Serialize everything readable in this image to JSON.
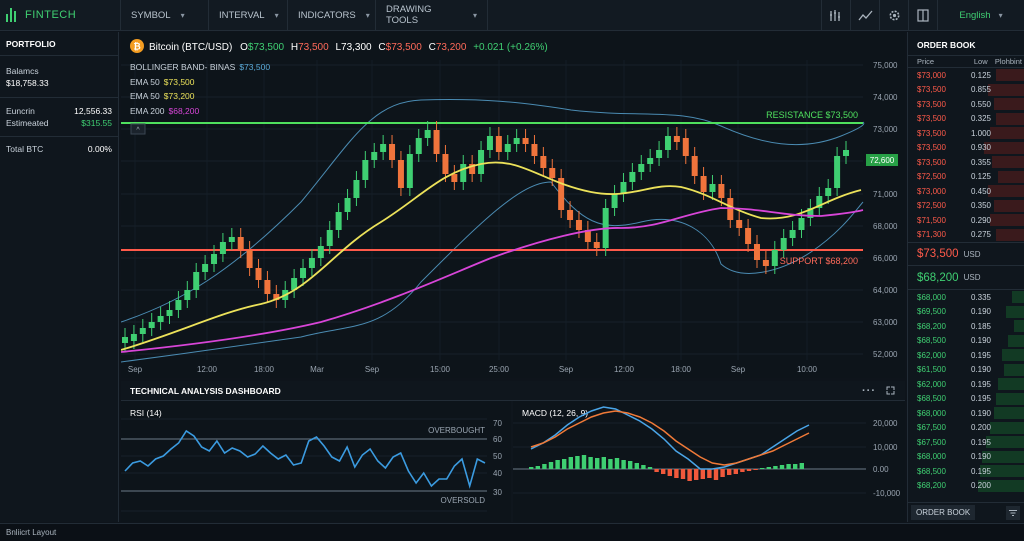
{
  "topbar": {
    "logo": "FINTECH",
    "menus": [
      "SYMBOL",
      "INTERVAL",
      "INDICATORS",
      "DRAWING TOOLS"
    ],
    "language": "English",
    "tool_icons": [
      "indicator-bars-icon",
      "line-chart-icon",
      "gear-icon",
      "panel-icon"
    ]
  },
  "portfolio": {
    "title": "PORTFOLIO",
    "balance_label": "Balamcs",
    "balance_value": "$18,758.33",
    "rows": [
      {
        "label": "Euncrin",
        "value": "12,556.33"
      },
      {
        "label": "Estimeated",
        "value": "$315.55"
      }
    ],
    "total_label": "Total BTC",
    "total_value": "0.00%"
  },
  "header": {
    "title": "Bitcoin (BTC/USD)",
    "o_label": "O",
    "o": "$73,500",
    "h_label": "H",
    "h": "73,500",
    "l_label": "L",
    "l": "73,300",
    "c_label": "C",
    "c": "$73,500",
    "c2_label": "C",
    "c2": "73,200",
    "change": "+0.021 (+0.26%)",
    "coin_symbol": "₿"
  },
  "indicators": [
    {
      "label": "BOLLINGER BAND- BINAS",
      "value": "$73,500",
      "color": "#5aa9d8"
    },
    {
      "label": "EMA 50",
      "value": "$73,500",
      "color": "#e6d94a"
    },
    {
      "label": "EMA 50",
      "value": "$73,200",
      "color": "#e6d94a"
    },
    {
      "label": "EMA 200",
      "value": "$68,200",
      "color": "#d845d8"
    }
  ],
  "resistance_label": "RESISTANCE $73,500",
  "support_label": "SUPPORT $68,200",
  "price_tag": "72,600",
  "y_ticks": [
    "75,000",
    "74,000",
    "73,000",
    "72,000",
    "71,000",
    "68,000",
    "66,000",
    "64,000",
    "63,000",
    "52,000"
  ],
  "x_ticks": [
    "Sep",
    "12:00",
    "18:00",
    "Mar",
    "Sep",
    "15:00",
    "25:00",
    "Sep",
    "12:00",
    "18:00",
    "Sep",
    "10:00"
  ],
  "dashboard": {
    "title": "TECHNICAL ANALYSIS DASHBOARD",
    "rsi": {
      "title": "RSI (14)",
      "overbought": "OVERBOUGHT",
      "oversold": "OVERSOLD",
      "ticks": [
        "70",
        "60",
        "50",
        "40",
        "30"
      ]
    },
    "macd": {
      "title": "MACD (12, 26, 9)",
      "ticks": [
        "20,000",
        "10,000",
        "0.00",
        "-10,000"
      ]
    }
  },
  "orderbook": {
    "title": "ORDER BOOK",
    "col_price": "Price",
    "col_low": "Low",
    "col_third": "Plohbint",
    "asks": [
      [
        "$73,000",
        "0.125"
      ],
      [
        "$73,500",
        "0.855"
      ],
      [
        "$73,500",
        "0.550"
      ],
      [
        "$73,500",
        "0.325"
      ],
      [
        "$73,500",
        "1.000"
      ],
      [
        "$73,500",
        "0.930"
      ],
      [
        "$73,500",
        "0.355"
      ],
      [
        "$72,500",
        "0.125"
      ],
      [
        "$73,000",
        "0.450"
      ],
      [
        "$72,500",
        "0.350"
      ],
      [
        "$71,500",
        "0.290"
      ],
      [
        "$71,300",
        "0.275"
      ]
    ],
    "mid_ask": "$73,500",
    "mid_bid": "$68,200",
    "mid_unit": "USD",
    "bids": [
      [
        "$68,000",
        "0.335"
      ],
      [
        "$69,500",
        "0.190"
      ],
      [
        "$68,200",
        "0.185"
      ],
      [
        "$68,500",
        "0.190"
      ],
      [
        "$62,000",
        "0.195"
      ],
      [
        "$61,500",
        "0.190"
      ],
      [
        "$62,000",
        "0.195"
      ],
      [
        "$68,500",
        "0.195"
      ],
      [
        "$68,000",
        "0.190"
      ],
      [
        "$67,500",
        "0.200"
      ],
      [
        "$67,500",
        "0.195"
      ],
      [
        "$68,000",
        "0.190"
      ],
      [
        "$68,500",
        "0.195"
      ],
      [
        "$68,200",
        "0.200"
      ]
    ],
    "footer_button": "ORDER BOOK"
  },
  "status": "Bnliicrt Layout",
  "colors": {
    "up": "#3fcf72",
    "down": "#f0743c",
    "resistance": "#4fe05e",
    "support": "#ff5a4a",
    "ema_yellow": "#ece25a",
    "ema_magenta": "#d845d8",
    "bollinger": "#5aa9d8"
  }
}
